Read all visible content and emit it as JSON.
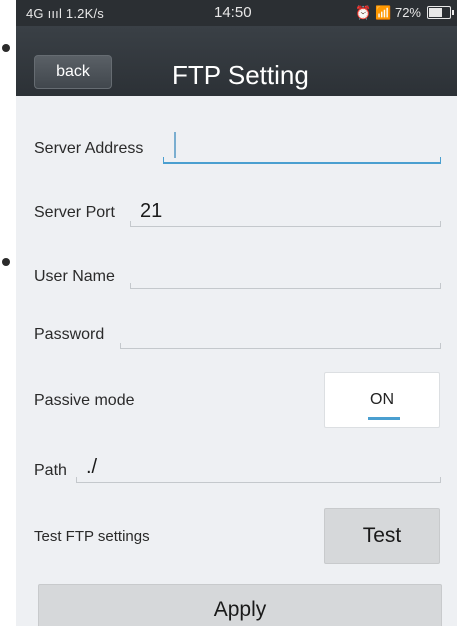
{
  "status_bar": {
    "network": "4G",
    "signal": "ıııl",
    "speed": "1.2K/s",
    "time": "14:50",
    "alarm_icon": "alarm-clock-icon",
    "wifi_icon": "wifi-icon",
    "battery_percent": "72%",
    "battery_level": 0.72
  },
  "header": {
    "back_label": "back",
    "title": "FTP Setting"
  },
  "form": {
    "server_address": {
      "label": "Server Address",
      "value": ""
    },
    "server_port": {
      "label": "Server Port",
      "value": "21"
    },
    "user_name": {
      "label": "User Name",
      "value": ""
    },
    "password": {
      "label": "Password",
      "value": ""
    },
    "passive_mode": {
      "label": "Passive mode",
      "value": "ON"
    },
    "path": {
      "label": "Path",
      "value": "./"
    },
    "test_ftp": {
      "label": "Test FTP settings",
      "button": "Test"
    }
  },
  "apply_label": "Apply",
  "colors": {
    "header_bg": "#2c3136",
    "page_bg": "#eef0f3",
    "accent": "#4a9fd0",
    "button_bg": "#d6d8da"
  }
}
